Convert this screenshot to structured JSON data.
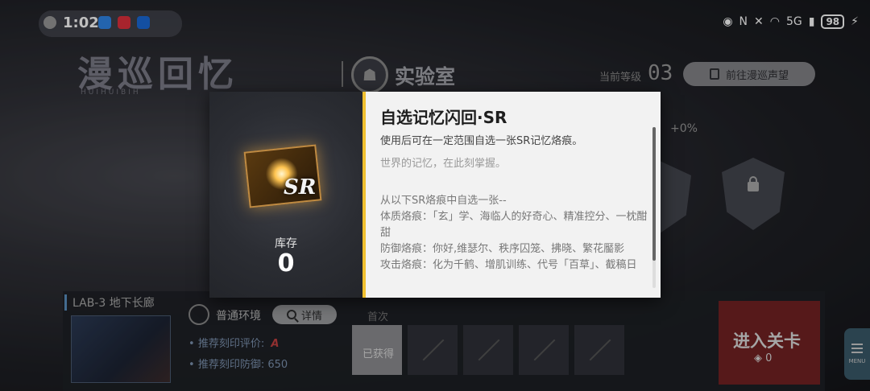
{
  "status_bar": {
    "time": "1:02",
    "network": "5G",
    "battery": "98"
  },
  "background": {
    "title": "漫巡回忆",
    "subtitle": "HUIHUIBIH",
    "lab_title": "实验室",
    "level_label": "当前等级",
    "level_value": "03",
    "goto_button": "前往漫巡声望",
    "bonus": "+0%",
    "lab_name": "LAB-3 地下长廊",
    "environment_label": "普通环境",
    "details_button": "详情",
    "recommended_rating_label": "推荐刻印评价:",
    "recommended_rating_value": "A",
    "recommended_defense_label": "推荐刻印防御:",
    "recommended_defense_value": "650",
    "slots_header": "首次",
    "first_slot_label": "已获得",
    "enter_button": "进入关卡",
    "enter_cost": "0",
    "menu_label": "MENU"
  },
  "modal": {
    "item_rarity": "SR",
    "stock_label": "库存",
    "stock_value": "0",
    "title": "自选记忆闪回·SR",
    "description": "使用后可在一定范围自选一张SR记忆烙痕。",
    "flavor": "世界的记忆，在此刻掌握。",
    "list": [
      "从以下SR烙痕中自选一张--",
      "体质烙痕：「玄」学、海临人的好奇心、精准控分、一枕酣甜",
      "防御烙痕：你好,维瑟尔、秩序囚笼、拂晓、繁花靨影",
      "攻击烙痕：化为千鹤、增肌训练、代号「百草」、截稿日"
    ]
  },
  "colors": {
    "accent_yellow": "#f0c030",
    "enter_red": "#8a2323",
    "stat_blue": "#7d93b0"
  }
}
